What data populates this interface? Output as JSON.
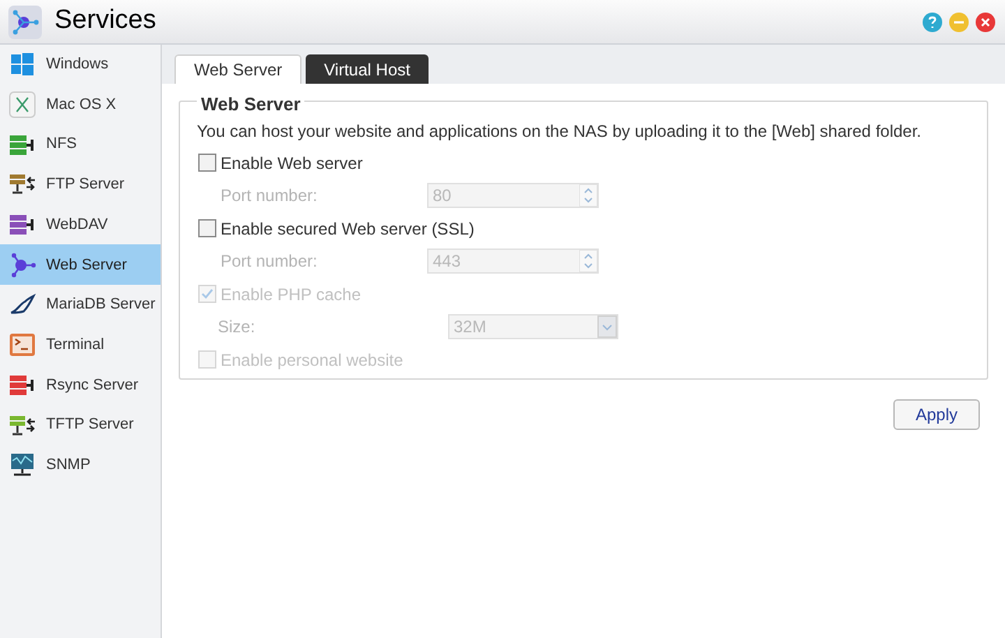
{
  "window": {
    "title": "Services"
  },
  "sidebar": {
    "items": [
      {
        "label": "Windows",
        "kind": "windows",
        "selected": false
      },
      {
        "label": "Mac OS X",
        "kind": "mac",
        "selected": false
      },
      {
        "label": "NFS",
        "kind": "nfs",
        "selected": false
      },
      {
        "label": "FTP Server",
        "kind": "ftp",
        "selected": false
      },
      {
        "label": "WebDAV",
        "kind": "webdav",
        "selected": false
      },
      {
        "label": "Web Server",
        "kind": "web",
        "selected": true
      },
      {
        "label": "MariaDB Server",
        "kind": "mariadb",
        "selected": false
      },
      {
        "label": "Terminal",
        "kind": "terminal",
        "selected": false
      },
      {
        "label": "Rsync Server",
        "kind": "rsync",
        "selected": false
      },
      {
        "label": "TFTP Server",
        "kind": "tftp",
        "selected": false
      },
      {
        "label": "SNMP",
        "kind": "snmp",
        "selected": false
      }
    ]
  },
  "tabs": [
    {
      "label": "Web Server",
      "selected": true
    },
    {
      "label": "Virtual Host",
      "selected": false
    }
  ],
  "group": {
    "title": "Web Server",
    "description": "You can host your website and applications on the NAS by uploading it to the [Web] shared folder.",
    "rows": [
      {
        "kind": "checkbox",
        "label": "Enable Web server",
        "checked": false,
        "disabled": false
      },
      {
        "kind": "number",
        "label": "Port number:",
        "value": "80",
        "disabled": true
      },
      {
        "kind": "checkbox",
        "label": "Enable secured Web server (SSL)",
        "checked": false,
        "disabled": false
      },
      {
        "kind": "number",
        "label": "Port number:",
        "value": "443",
        "disabled": true
      },
      {
        "kind": "checkbox",
        "label": "Enable PHP cache",
        "checked": true,
        "disabled": true
      },
      {
        "kind": "select",
        "label": "Size:",
        "value": "32M",
        "disabled": true
      },
      {
        "kind": "checkbox",
        "label": "Enable personal website",
        "checked": false,
        "disabled": true
      }
    ]
  },
  "apply_button": "Apply"
}
